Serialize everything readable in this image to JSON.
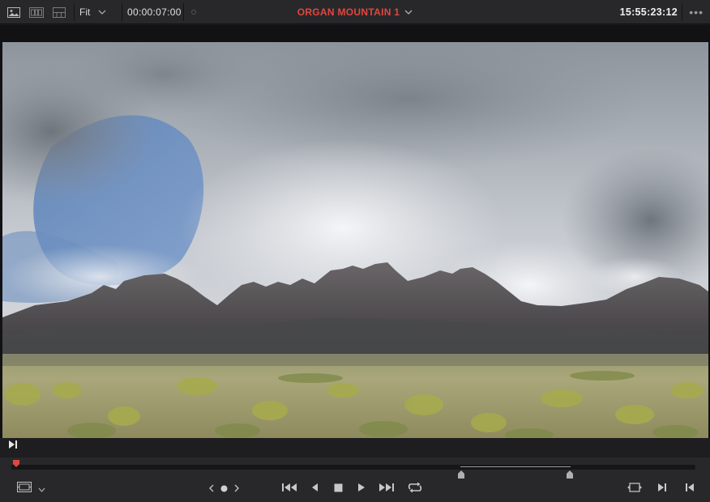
{
  "toolbar": {
    "fit_label": "Fit",
    "timecode_left": "00:00:07:00",
    "clip_title": "ORGAN MOUNTAIN 1",
    "timecode_right": "15:55:23:12",
    "more_label": "•••"
  },
  "icons": {
    "view_image": "image-view-icon",
    "view_film": "film-strip-icon",
    "view_layout": "layout-icon",
    "chevron": "chevron-down-icon",
    "mark_in": "mark-in-icon",
    "playhead": "playhead-icon",
    "viewer_options": "viewer-options-icon",
    "prev_clip": "prev-clip-icon",
    "jog": "jog-wheel-icon",
    "next_clip": "next-clip-icon",
    "go_start": "go-to-start-icon",
    "play_reverse": "play-reverse-icon",
    "stop": "stop-icon",
    "play": "play-icon",
    "go_end": "go-to-end-icon",
    "loop": "loop-icon",
    "match_frame": "match-frame-icon",
    "next_frame": "next-frame-marker-icon",
    "prev_frame": "prev-frame-marker-icon"
  },
  "colors": {
    "title_accent": "#e2463e",
    "playhead": "#e2463e",
    "panel": "#28282b",
    "background": "#1b1b1d"
  },
  "transport": {
    "playhead_position": 0.006,
    "range_start": 0.656,
    "range_end": 0.817
  }
}
